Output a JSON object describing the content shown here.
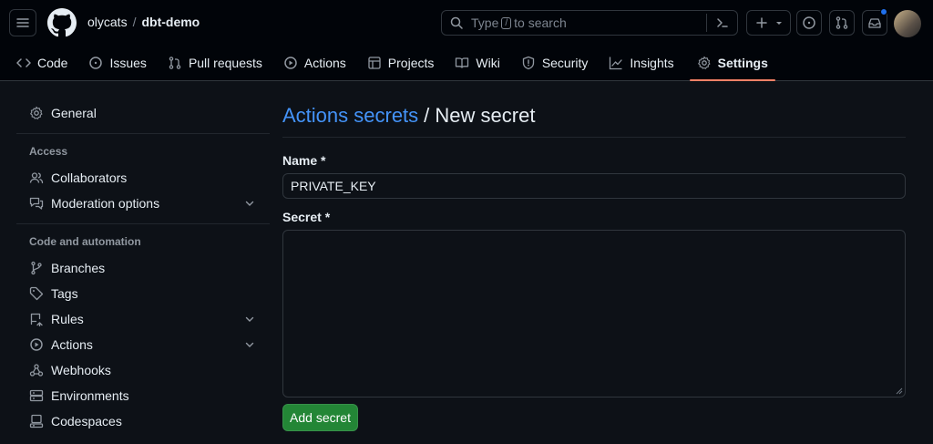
{
  "header": {
    "owner": "olycats",
    "separator": "/",
    "repo": "dbt-demo",
    "search": {
      "prefix": "Type",
      "key": "/",
      "suffix": "to search"
    }
  },
  "tabs": [
    {
      "label": "Code",
      "icon": "code-icon"
    },
    {
      "label": "Issues",
      "icon": "issue-icon"
    },
    {
      "label": "Pull requests",
      "icon": "pull-request-icon"
    },
    {
      "label": "Actions",
      "icon": "play-icon"
    },
    {
      "label": "Projects",
      "icon": "table-icon"
    },
    {
      "label": "Wiki",
      "icon": "book-icon"
    },
    {
      "label": "Security",
      "icon": "shield-icon"
    },
    {
      "label": "Insights",
      "icon": "graph-icon"
    },
    {
      "label": "Settings",
      "icon": "gear-icon",
      "active": true
    }
  ],
  "sidebar": {
    "general": "General",
    "access_title": "Access",
    "collaborators": "Collaborators",
    "moderation": "Moderation options",
    "code_title": "Code and automation",
    "branches": "Branches",
    "tags": "Tags",
    "rules": "Rules",
    "actions": "Actions",
    "webhooks": "Webhooks",
    "environments": "Environments",
    "codespaces": "Codespaces"
  },
  "main": {
    "breadcrumb_link": "Actions secrets",
    "breadcrumb_rest": "/ New secret",
    "name_label": "Name *",
    "name_value": "PRIVATE_KEY",
    "secret_label": "Secret *",
    "secret_value": "",
    "submit": "Add secret"
  },
  "colors": {
    "accent_link": "#4493f8",
    "tab_underline": "#f78166",
    "primary_button": "#238636",
    "notification_dot": "#1f6feb"
  }
}
